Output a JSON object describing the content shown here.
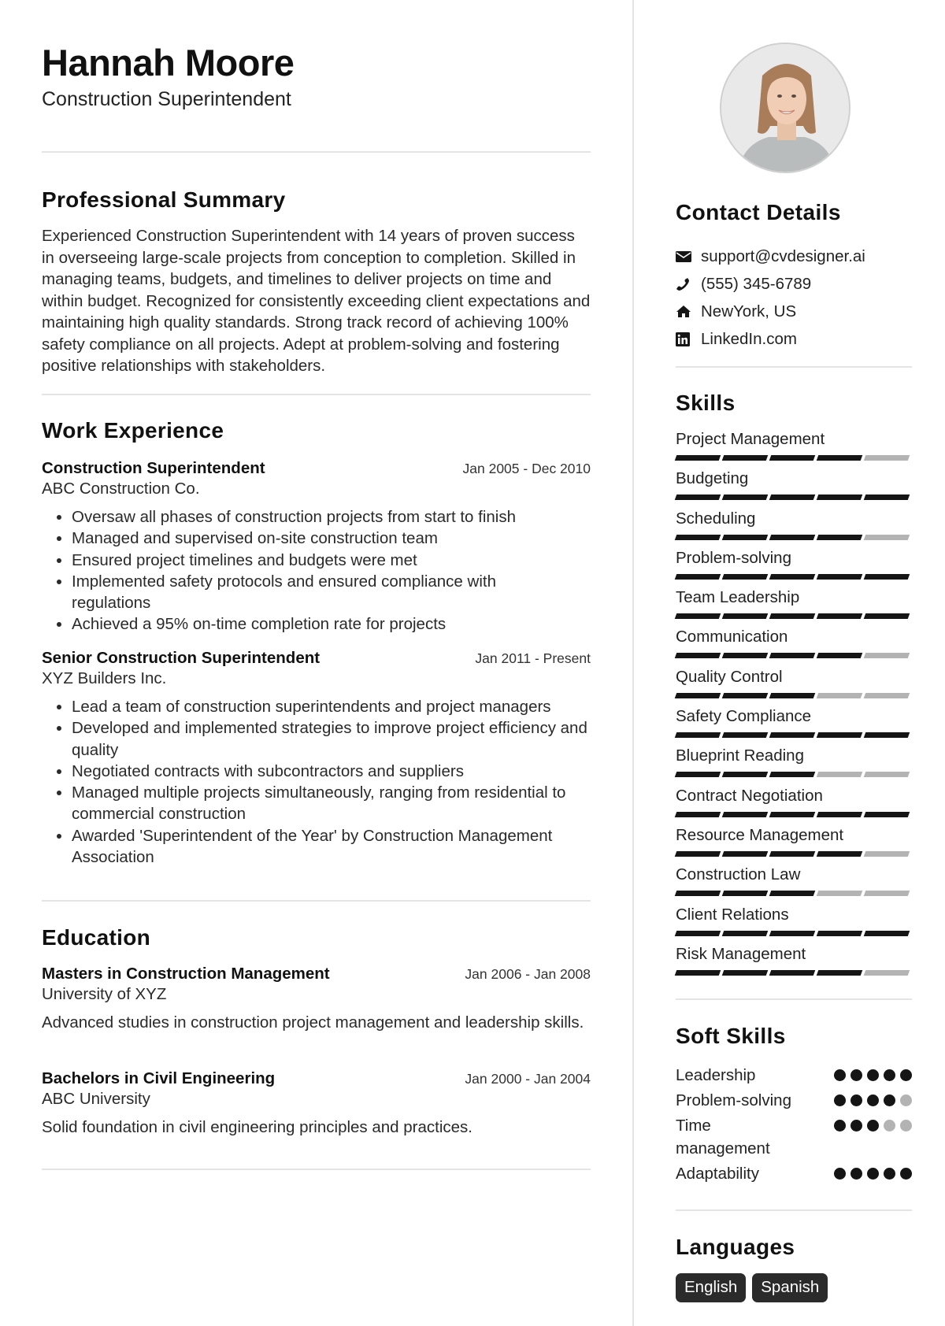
{
  "header": {
    "name": "Hannah Moore",
    "title": "Construction Superintendent"
  },
  "summary": {
    "heading": "Professional Summary",
    "text": "Experienced Construction Superintendent with 14 years of proven success in overseeing large-scale projects from conception to completion. Skilled in managing teams, budgets, and timelines to deliver projects on time and within budget. Recognized for consistently exceeding client expectations and maintaining high quality standards. Strong track record of achieving 100% safety compliance on all projects. Adept at problem-solving and fostering positive relationships with stakeholders."
  },
  "experience": {
    "heading": "Work Experience",
    "jobs": [
      {
        "title": "Construction Superintendent",
        "date": "Jan 2005 - Dec 2010",
        "org": "ABC Construction Co.",
        "bullets": [
          "Oversaw all phases of construction projects from start to finish",
          "Managed and supervised on-site construction team",
          "Ensured project timelines and budgets were met",
          "Implemented safety protocols and ensured compliance with regulations",
          "Achieved a 95% on-time completion rate for projects"
        ]
      },
      {
        "title": "Senior Construction Superintendent",
        "date": "Jan 2011 - Present",
        "org": "XYZ Builders Inc.",
        "bullets": [
          "Lead a team of construction superintendents and project managers",
          "Developed and implemented strategies to improve project efficiency and quality",
          "Negotiated contracts with subcontractors and suppliers",
          "Managed multiple projects simultaneously, ranging from residential to commercial construction",
          "Awarded 'Superintendent of the Year' by Construction Management Association"
        ]
      }
    ]
  },
  "education": {
    "heading": "Education",
    "items": [
      {
        "degree": "Masters in Construction Management",
        "date": "Jan 2006 - Jan 2008",
        "school": "University of XYZ",
        "desc": "Advanced studies in construction project management and leadership skills."
      },
      {
        "degree": "Bachelors in Civil Engineering",
        "date": "Jan 2000 - Jan 2004",
        "school": "ABC University",
        "desc": "Solid foundation in civil engineering principles and practices."
      }
    ]
  },
  "contact": {
    "heading": "Contact Details",
    "items": [
      {
        "icon": "envelope-icon",
        "text": "support@cvdesigner.ai"
      },
      {
        "icon": "phone-icon",
        "text": "(555) 345-6789"
      },
      {
        "icon": "home-icon",
        "text": "NewYork, US"
      },
      {
        "icon": "linkedin-icon",
        "text": "LinkedIn.com"
      }
    ]
  },
  "skills": {
    "heading": "Skills",
    "max": 5,
    "items": [
      {
        "name": "Project Management",
        "level": 4
      },
      {
        "name": "Budgeting",
        "level": 5
      },
      {
        "name": "Scheduling",
        "level": 4
      },
      {
        "name": "Problem-solving",
        "level": 5
      },
      {
        "name": "Team Leadership",
        "level": 5
      },
      {
        "name": "Communication",
        "level": 4
      },
      {
        "name": "Quality Control",
        "level": 3
      },
      {
        "name": "Safety Compliance",
        "level": 5
      },
      {
        "name": "Blueprint Reading",
        "level": 3
      },
      {
        "name": "Contract Negotiation",
        "level": 5
      },
      {
        "name": "Resource Management",
        "level": 4
      },
      {
        "name": "Construction Law",
        "level": 3
      },
      {
        "name": "Client Relations",
        "level": 5
      },
      {
        "name": "Risk Management",
        "level": 4
      }
    ]
  },
  "soft_skills": {
    "heading": "Soft Skills",
    "max": 5,
    "items": [
      {
        "name": "Leadership",
        "level": 5
      },
      {
        "name": "Problem-solving",
        "level": 4
      },
      {
        "name": "Time management",
        "level": 3
      },
      {
        "name": "Adaptability",
        "level": 5
      }
    ]
  },
  "languages": {
    "heading": "Languages",
    "items": [
      "English",
      "Spanish"
    ]
  },
  "colors": {
    "filled": "#151515",
    "empty": "#b3b3b3",
    "divider": "#e4e4e4",
    "tag_bg": "#2b2b2b"
  }
}
